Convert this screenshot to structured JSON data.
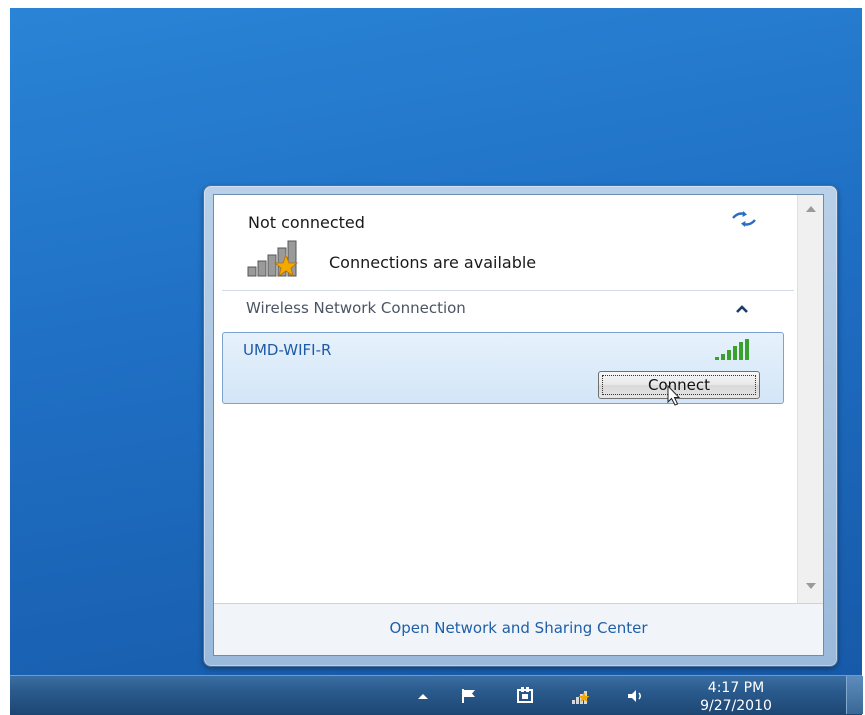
{
  "popup": {
    "status_title": "Not connected",
    "availability_text": "Connections are available",
    "section_title": "Wireless Network Connection",
    "network": {
      "name": "UMD-WIFI-R",
      "connect_label": "Connect"
    },
    "footer_link": "Open Network and Sharing Center"
  },
  "taskbar": {
    "clock_time": "4:17 PM",
    "clock_date": "9/27/2010",
    "tray_icons": [
      "show-hidden-icons-arrow",
      "action-center-flag-icon",
      "power-plug-icon",
      "network-signal-icon",
      "speaker-volume-icon"
    ]
  },
  "colors": {
    "desktop_blue": "#1f6fc4",
    "link_blue": "#1f5fa8",
    "signal_green": "#3aa12f",
    "warning_star": "#f2a900"
  }
}
